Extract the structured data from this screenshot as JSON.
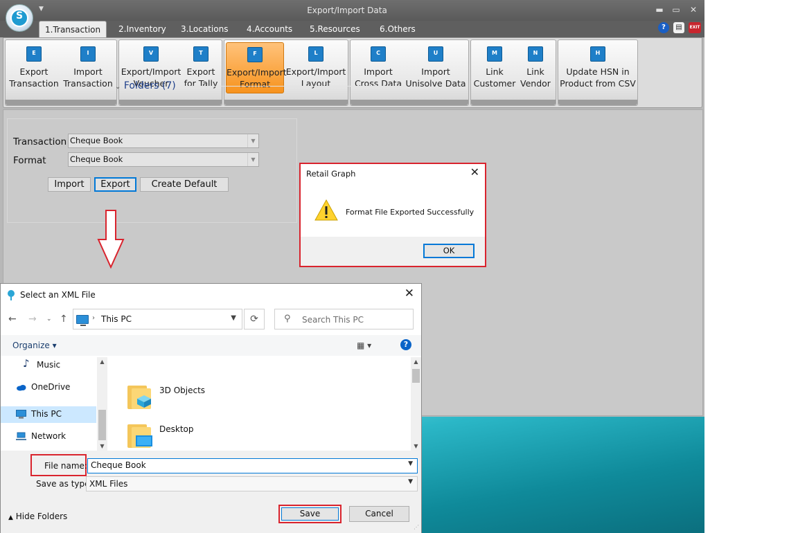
{
  "app": {
    "title": "Export/Import Data",
    "logo_letter": "S",
    "colors": {
      "accent_active": "#f7931e",
      "ribbon_icon": "#1f7fc8",
      "highlight_red": "#d9232d",
      "focus_blue": "#0078d7"
    }
  },
  "window_controls": {
    "minimize": "▬",
    "restore": "▭",
    "close": "✕"
  },
  "tabs": [
    {
      "label": "1.Transaction"
    },
    {
      "label": "2.Inventory"
    },
    {
      "label": "3.Locations"
    },
    {
      "label": "4.Accounts"
    },
    {
      "label": "5.Resources"
    },
    {
      "label": "6.Others"
    }
  ],
  "tab_icons": {
    "help": "?",
    "notes": "▤",
    "exit": "EXIT"
  },
  "ribbon": {
    "buttons": [
      {
        "label": "Export\nTransaction",
        "icon": "E"
      },
      {
        "label": "Import\nTransaction",
        "icon": "I"
      },
      {
        "label": "Export/Import\nVoucher",
        "icon": "V"
      },
      {
        "label": "Export\nfor Tally",
        "icon": "T"
      },
      {
        "label": "Export/Import\nFormat",
        "icon": "F"
      },
      {
        "label": "Export/Import\nLayout",
        "icon": "L"
      },
      {
        "label": "Import\nCross Data",
        "icon": "C"
      },
      {
        "label": "Import\nUnisolve Data",
        "icon": "U"
      },
      {
        "label": "Link\nCustomer",
        "icon": "M"
      },
      {
        "label": "Link\nVendor",
        "icon": "N"
      },
      {
        "label": "Update HSN in\nProduct from CSV",
        "icon": "H"
      }
    ]
  },
  "form": {
    "transaction_label": "Transaction",
    "transaction_value": "Cheque Book",
    "format_label": "Format",
    "format_value": "Cheque Book",
    "import_label": "Import",
    "export_label": "Export",
    "create_default_label": "Create Default"
  },
  "message_box": {
    "title": "Retail Graph",
    "message": "Format File Exported Successfully",
    "ok_label": "OK"
  },
  "save_dialog": {
    "title": "Select an XML File",
    "address_path": "This PC",
    "search_placeholder": "Search This PC",
    "organize_label": "Organize",
    "nav_items": [
      {
        "label": "Music"
      },
      {
        "label": "OneDrive"
      },
      {
        "label": "This PC"
      },
      {
        "label": "Network"
      }
    ],
    "folders_header": "Folders (7)",
    "folders": [
      {
        "label": "3D Objects"
      },
      {
        "label": "Desktop"
      }
    ],
    "file_name_label": "File name:",
    "file_name_value": "Cheque Book",
    "save_type_label": "Save as type:",
    "save_type_value": "XML Files",
    "hide_folders_label": "Hide Folders",
    "save_label": "Save",
    "cancel_label": "Cancel"
  }
}
